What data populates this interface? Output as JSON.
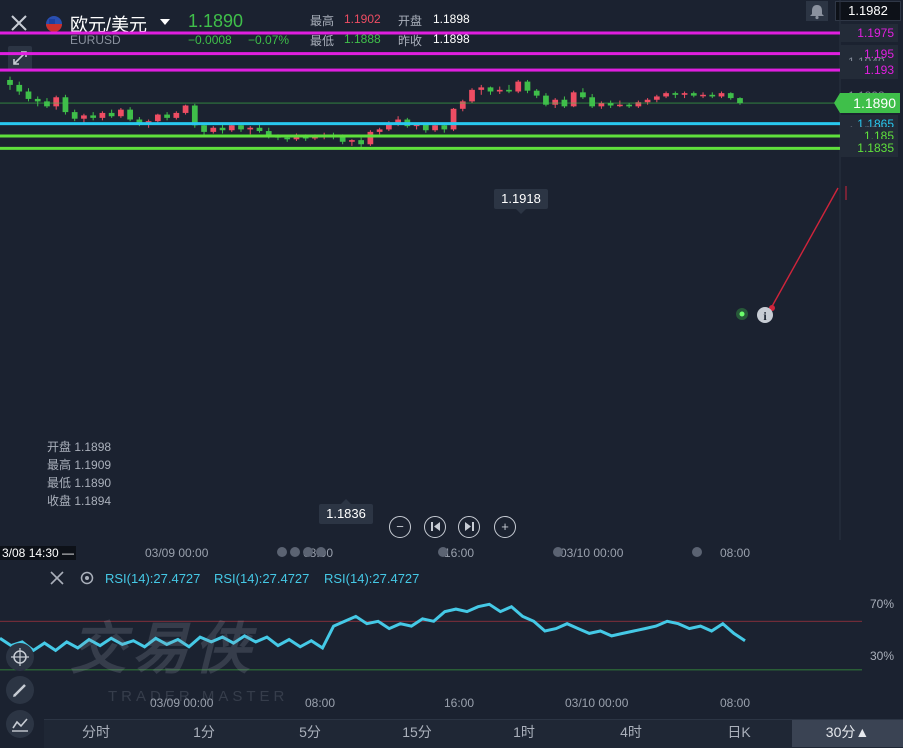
{
  "header": {
    "pair_name": "欧元/美元",
    "symbol": "EURUSD",
    "price": "1.1890",
    "change": "−0.0008",
    "change_pct": "−0.07%",
    "high_label": "最高",
    "high_value": "1.1902",
    "low_label": "最低",
    "low_value": "1.1888",
    "open_label": "开盘",
    "open_value": "1.1898",
    "prevclose_label": "昨收",
    "prevclose_value": "1.1898",
    "top_right_price": "1.1982"
  },
  "price_axis": {
    "labels": [
      "1.1975",
      "1.195",
      "1.1940",
      "1.193",
      "1.1898",
      "1.1890",
      "1.1865",
      "1.1856",
      "1.185",
      "1.1835"
    ]
  },
  "lines": [
    {
      "price": "1.1975",
      "color": "#e01fdf"
    },
    {
      "price": "1.195",
      "color": "#e01fdf"
    },
    {
      "price": "1.193",
      "color": "#e01fdf"
    },
    {
      "price": "1.1865",
      "color": "#28c8ef"
    },
    {
      "price": "1.185",
      "color": "#5fe03c"
    },
    {
      "price": "1.1835",
      "color": "#5fe03c"
    }
  ],
  "callouts": {
    "high": "1.1918",
    "low": "1.1836"
  },
  "ohlc_panel": {
    "open": "开盘 1.1898",
    "high": "最高 1.1909",
    "low": "最低 1.1890",
    "close": "收盘 1.1894"
  },
  "time_axis": {
    "crosshair": "3/08 14:30 —",
    "labels": [
      "03/09 00:00",
      "08:00",
      "16:00",
      "03/10 00:00",
      "08:00"
    ]
  },
  "rsi": {
    "labels": [
      "RSI(14):27.4727",
      "RSI(14):27.4727",
      "RSI(14):27.4727"
    ],
    "level_high": "70%",
    "level_low": "30%",
    "time_labels": [
      "03/09 00:00",
      "08:00",
      "16:00",
      "03/10 00:00",
      "08:00"
    ]
  },
  "watermark": {
    "main": "交易侠",
    "sub": "TRADER MASTER"
  },
  "tabs": [
    "分时",
    "1分",
    "5分",
    "15分",
    "1时",
    "4时",
    "日K",
    "30分▲"
  ],
  "colors": {
    "up": "#ee4d63",
    "down": "#3fbf4a",
    "rsi": "#45c9e6",
    "bg": "#1b2230"
  },
  "candles": [
    [
      1.1918,
      1.1922,
      1.1906,
      1.1912
    ],
    [
      1.1912,
      1.1916,
      1.19,
      1.1904
    ],
    [
      1.1904,
      1.1908,
      1.1892,
      1.1895
    ],
    [
      1.1895,
      1.1898,
      1.1886,
      1.1892
    ],
    [
      1.1892,
      1.1896,
      1.1884,
      1.1886
    ],
    [
      1.1886,
      1.1899,
      1.1882,
      1.1897
    ],
    [
      1.1897,
      1.19,
      1.1876,
      1.1879
    ],
    [
      1.1879,
      1.1882,
      1.1868,
      1.1871
    ],
    [
      1.1871,
      1.1877,
      1.1866,
      1.1875
    ],
    [
      1.1875,
      1.1879,
      1.1869,
      1.1872
    ],
    [
      1.1872,
      1.188,
      1.1869,
      1.1878
    ],
    [
      1.1878,
      1.1882,
      1.1872,
      1.1874
    ],
    [
      1.1874,
      1.1884,
      1.1872,
      1.1882
    ],
    [
      1.1882,
      1.1885,
      1.1868,
      1.187
    ],
    [
      1.187,
      1.1873,
      1.1862,
      1.1865
    ],
    [
      1.1865,
      1.187,
      1.186,
      1.1868
    ],
    [
      1.1868,
      1.1877,
      1.1865,
      1.1876
    ],
    [
      1.1876,
      1.1879,
      1.1869,
      1.1872
    ],
    [
      1.1872,
      1.188,
      1.187,
      1.1878
    ],
    [
      1.1878,
      1.1888,
      1.1876,
      1.1887
    ],
    [
      1.1887,
      1.1889,
      1.186,
      1.1863
    ],
    [
      1.1863,
      1.1866,
      1.185,
      1.1855
    ],
    [
      1.1855,
      1.1862,
      1.1853,
      1.186
    ],
    [
      1.186,
      1.1864,
      1.1853,
      1.1857
    ],
    [
      1.1857,
      1.1865,
      1.1855,
      1.1863
    ],
    [
      1.1863,
      1.1866,
      1.1855,
      1.1858
    ],
    [
      1.1858,
      1.1862,
      1.1852,
      1.186
    ],
    [
      1.186,
      1.1864,
      1.1854,
      1.1856
    ],
    [
      1.1856,
      1.186,
      1.1847,
      1.185
    ],
    [
      1.185,
      1.1852,
      1.1845,
      1.1848
    ],
    [
      1.1848,
      1.185,
      1.1843,
      1.1846
    ],
    [
      1.1846,
      1.1853,
      1.1844,
      1.1849
    ],
    [
      1.1849,
      1.1852,
      1.1844,
      1.1847
    ],
    [
      1.1847,
      1.1852,
      1.1845,
      1.185
    ],
    [
      1.185,
      1.1854,
      1.1846,
      1.1851
    ],
    [
      1.1851,
      1.1854,
      1.1846,
      1.1849
    ],
    [
      1.1849,
      1.1852,
      1.184,
      1.1843
    ],
    [
      1.1843,
      1.1846,
      1.1838,
      1.1845
    ],
    [
      1.1845,
      1.1848,
      1.1836,
      1.184
    ],
    [
      1.184,
      1.1857,
      1.1838,
      1.1855
    ],
    [
      1.1855,
      1.186,
      1.1852,
      1.1858
    ],
    [
      1.1858,
      1.1868,
      1.1856,
      1.1866
    ],
    [
      1.1866,
      1.1874,
      1.1862,
      1.187
    ],
    [
      1.187,
      1.1872,
      1.186,
      1.1862
    ],
    [
      1.1862,
      1.1866,
      1.1858,
      1.1864
    ],
    [
      1.1864,
      1.1866,
      1.1854,
      1.1857
    ],
    [
      1.1857,
      1.1865,
      1.1855,
      1.1863
    ],
    [
      1.1863,
      1.1866,
      1.1854,
      1.1858
    ],
    [
      1.1858,
      1.1884,
      1.1856,
      1.1883
    ],
    [
      1.1883,
      1.1894,
      1.188,
      1.1892
    ],
    [
      1.1892,
      1.1908,
      1.189,
      1.1906
    ],
    [
      1.1906,
      1.1912,
      1.19,
      1.1909
    ],
    [
      1.1909,
      1.191,
      1.19,
      1.1904
    ],
    [
      1.1904,
      1.191,
      1.1901,
      1.1906
    ],
    [
      1.1906,
      1.1912,
      1.1902,
      1.1904
    ],
    [
      1.1904,
      1.1918,
      1.1902,
      1.1916
    ],
    [
      1.1916,
      1.1918,
      1.1902,
      1.1905
    ],
    [
      1.1905,
      1.1907,
      1.1896,
      1.1899
    ],
    [
      1.1899,
      1.1902,
      1.1886,
      1.1888
    ],
    [
      1.1888,
      1.1896,
      1.1884,
      1.1894
    ],
    [
      1.1894,
      1.1898,
      1.1884,
      1.1886
    ],
    [
      1.1886,
      1.1905,
      1.1885,
      1.1903
    ],
    [
      1.1903,
      1.1908,
      1.1895,
      1.1897
    ],
    [
      1.1897,
      1.1901,
      1.1884,
      1.1886
    ],
    [
      1.1886,
      1.1892,
      1.1883,
      1.189
    ],
    [
      1.189,
      1.1893,
      1.1884,
      1.1887
    ],
    [
      1.1887,
      1.1893,
      1.1885,
      1.1888
    ],
    [
      1.1888,
      1.189,
      1.1884,
      1.1886
    ],
    [
      1.1886,
      1.1893,
      1.1884,
      1.1891
    ],
    [
      1.1891,
      1.1896,
      1.1888,
      1.1894
    ],
    [
      1.1894,
      1.19,
      1.1891,
      1.1898
    ],
    [
      1.1898,
      1.1904,
      1.1896,
      1.1902
    ],
    [
      1.1902,
      1.1904,
      1.1896,
      1.19
    ],
    [
      1.19,
      1.1904,
      1.1896,
      1.1902
    ],
    [
      1.1902,
      1.1904,
      1.1897,
      1.1899
    ],
    [
      1.1899,
      1.1903,
      1.1896,
      1.19
    ],
    [
      1.19,
      1.1903,
      1.1896,
      1.1898
    ],
    [
      1.1898,
      1.1904,
      1.1896,
      1.1902
    ],
    [
      1.1902,
      1.1903,
      1.1894,
      1.1896
    ],
    [
      1.1896,
      1.1897,
      1.1888,
      1.189
    ]
  ],
  "rsi_values": [
    56,
    50,
    53,
    46,
    52,
    46,
    53,
    48,
    55,
    50,
    56,
    51,
    54,
    49,
    56,
    51,
    55,
    49,
    57,
    53,
    57,
    52,
    58,
    53,
    57,
    50,
    55,
    49,
    54,
    48,
    66,
    70,
    74,
    68,
    70,
    64,
    68,
    66,
    72,
    70,
    78,
    80,
    78,
    82,
    84,
    78,
    82,
    74,
    70,
    62,
    64,
    68,
    64,
    60,
    62,
    58,
    60,
    62,
    64,
    66,
    70,
    68,
    64,
    66,
    62,
    68,
    60,
    54
  ],
  "rsi_ylim": [
    20,
    90
  ]
}
